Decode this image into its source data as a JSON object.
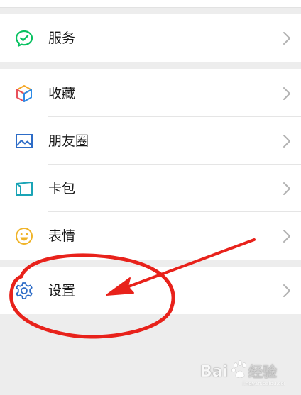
{
  "menu": {
    "items": [
      {
        "label": "服务",
        "icon": "service-icon"
      },
      {
        "label": "收藏",
        "icon": "favorites-cube-icon"
      },
      {
        "label": "朋友圈",
        "icon": "moments-image-icon"
      },
      {
        "label": "卡包",
        "icon": "card-wallet-icon"
      },
      {
        "label": "表情",
        "icon": "sticker-smiley-icon"
      },
      {
        "label": "设置",
        "icon": "settings-gear-icon"
      }
    ]
  },
  "colors": {
    "service_green": "#07c160",
    "accent_blue": "#2d6cc7",
    "annotation_red": "#e8221b",
    "background": "#ededed"
  },
  "watermark": {
    "text": "Bai 经验",
    "logo": "baidu-paw-logo"
  }
}
